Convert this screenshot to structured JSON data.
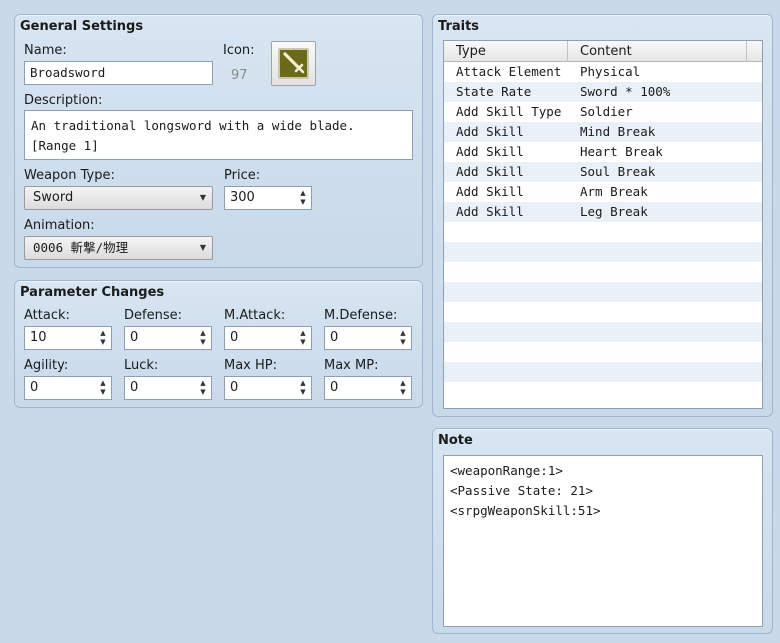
{
  "general": {
    "title": "General Settings",
    "name_label": "Name:",
    "name_value": "Broadsword",
    "icon_label": "Icon:",
    "icon_index": "97",
    "icon_name": "sword-icon",
    "description_label": "Description:",
    "description_lines": [
      "An traditional longsword with a wide blade.",
      "[Range 1]"
    ],
    "weapon_type_label": "Weapon Type:",
    "weapon_type_value": "Sword",
    "price_label": "Price:",
    "price_value": "300",
    "animation_label": "Animation:",
    "animation_value": "0006 斬撃/物理"
  },
  "params": {
    "title": "Parameter Changes",
    "fields": [
      {
        "label": "Attack:",
        "value": "10"
      },
      {
        "label": "Defense:",
        "value": "0"
      },
      {
        "label": "M.Attack:",
        "value": "0"
      },
      {
        "label": "M.Defense:",
        "value": "0"
      },
      {
        "label": "Agility:",
        "value": "0"
      },
      {
        "label": "Luck:",
        "value": "0"
      },
      {
        "label": "Max HP:",
        "value": "0"
      },
      {
        "label": "Max MP:",
        "value": "0"
      }
    ]
  },
  "traits": {
    "title": "Traits",
    "columns": [
      "Type",
      "Content"
    ],
    "rows": [
      [
        "Attack Element",
        "Physical"
      ],
      [
        "State Rate",
        "Sword * 100%"
      ],
      [
        "Add Skill Type",
        "Soldier"
      ],
      [
        "Add Skill",
        "Mind Break"
      ],
      [
        "Add Skill",
        "Heart Break"
      ],
      [
        "Add Skill",
        "Soul Break"
      ],
      [
        "Add Skill",
        "Arm Break"
      ],
      [
        "Add Skill",
        "Leg Break"
      ]
    ]
  },
  "note": {
    "title": "Note",
    "lines": [
      "<weaponRange:1>",
      "<Passive State: 21>",
      "<srpgWeaponSkill:51>"
    ]
  },
  "colors": {
    "panel": "#d2e0ee",
    "icon_tile": "#6b6a18",
    "icon_sword": "#f2f0d0"
  }
}
